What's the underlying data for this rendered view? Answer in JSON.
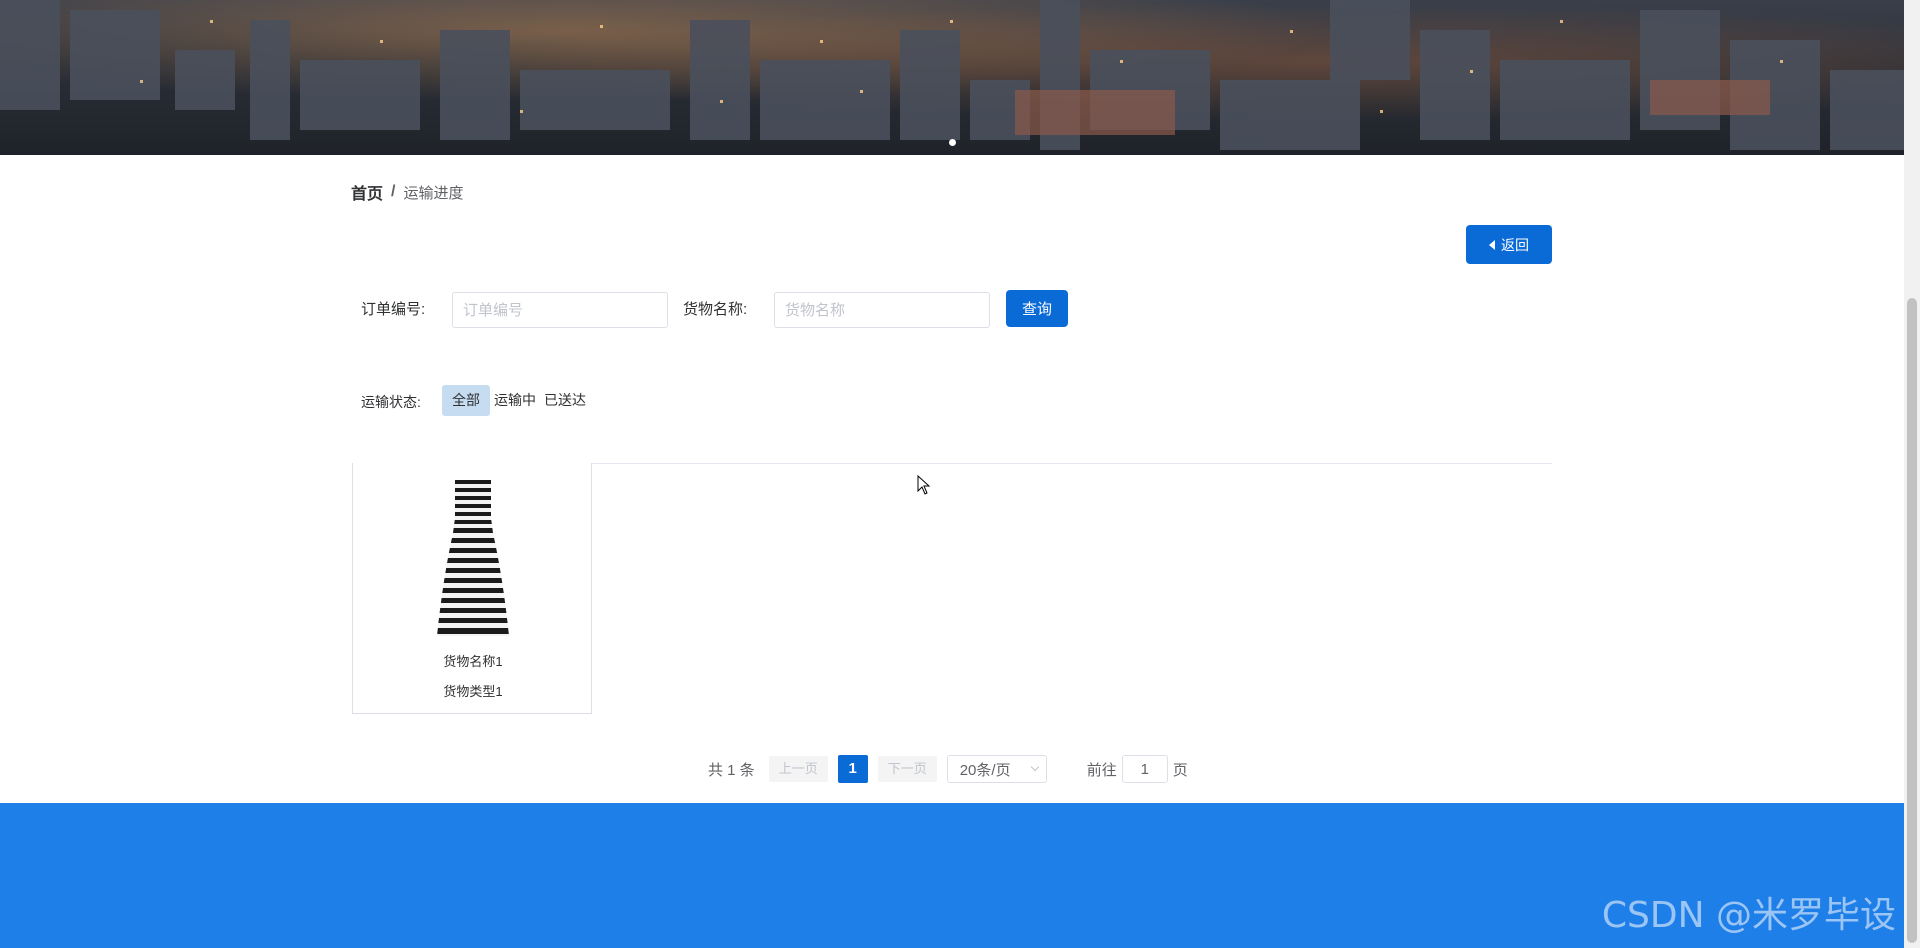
{
  "breadcrumb": {
    "home": "首页",
    "separator": "/",
    "current": "运输进度"
  },
  "back_button": {
    "label": "返回",
    "icon": "caret-left-icon"
  },
  "search": {
    "order_no_label": "订单编号:",
    "order_no_placeholder": "订单编号",
    "order_no_value": "",
    "goods_name_label": "货物名称:",
    "goods_name_placeholder": "货物名称",
    "goods_name_value": "",
    "query_label": "查询"
  },
  "status_filter": {
    "label": "运输状态:",
    "options": [
      "全部",
      "运输中",
      "已送达"
    ],
    "selected": "全部"
  },
  "items": [
    {
      "name": "货物名称1",
      "type": "货物类型1",
      "image": "striped-dress"
    }
  ],
  "pagination": {
    "total_text": "共 1 条",
    "prev_label": "上一页",
    "current_page": "1",
    "next_label": "下一页",
    "page_size": "20条/页",
    "goto_prefix": "前往",
    "goto_value": "1",
    "goto_suffix": "页"
  },
  "watermark": "CSDN @米罗毕设",
  "colors": {
    "primary": "#0a6ad6",
    "footer": "#1f7fe8",
    "active_status_bg": "#c6dcf1"
  }
}
